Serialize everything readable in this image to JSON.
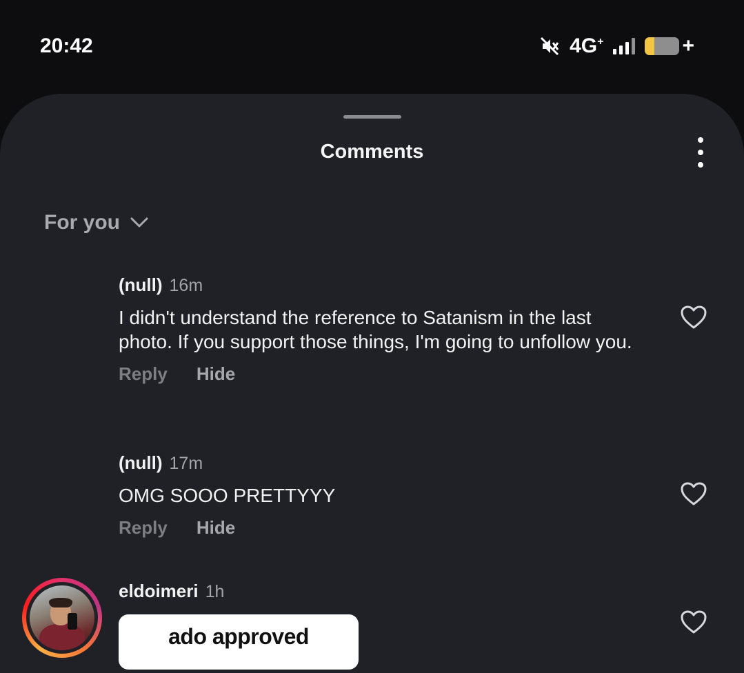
{
  "status_bar": {
    "time": "20:42",
    "network": "4G",
    "network_sup": "+",
    "battery_plus": "+",
    "icons": [
      "mute-icon",
      "signal-icon",
      "battery-icon"
    ]
  },
  "sheet": {
    "title": "Comments",
    "menu_icon": "more-vertical-icon"
  },
  "sort": {
    "label": "For you",
    "icon": "chevron-down-icon"
  },
  "comments": [
    {
      "username": "(null)",
      "time": "16m",
      "text": "I didn't understand the reference to Satanism in the last photo. If you support those things, I'm going to unfollow you.",
      "reply_label": "Reply",
      "hide_label": "Hide"
    },
    {
      "username": "(null)",
      "time": "17m",
      "text": "OMG SOOO PRETTYYY",
      "reply_label": "Reply",
      "hide_label": "Hide"
    },
    {
      "username": "eldoimeri",
      "time": "1h",
      "sticker_text": "ado approved"
    }
  ],
  "colors": {
    "sheet_bg": "#202126",
    "muted": "#a3a4aa",
    "story_ring": [
      "#e1306c",
      "#fcaf45"
    ]
  }
}
